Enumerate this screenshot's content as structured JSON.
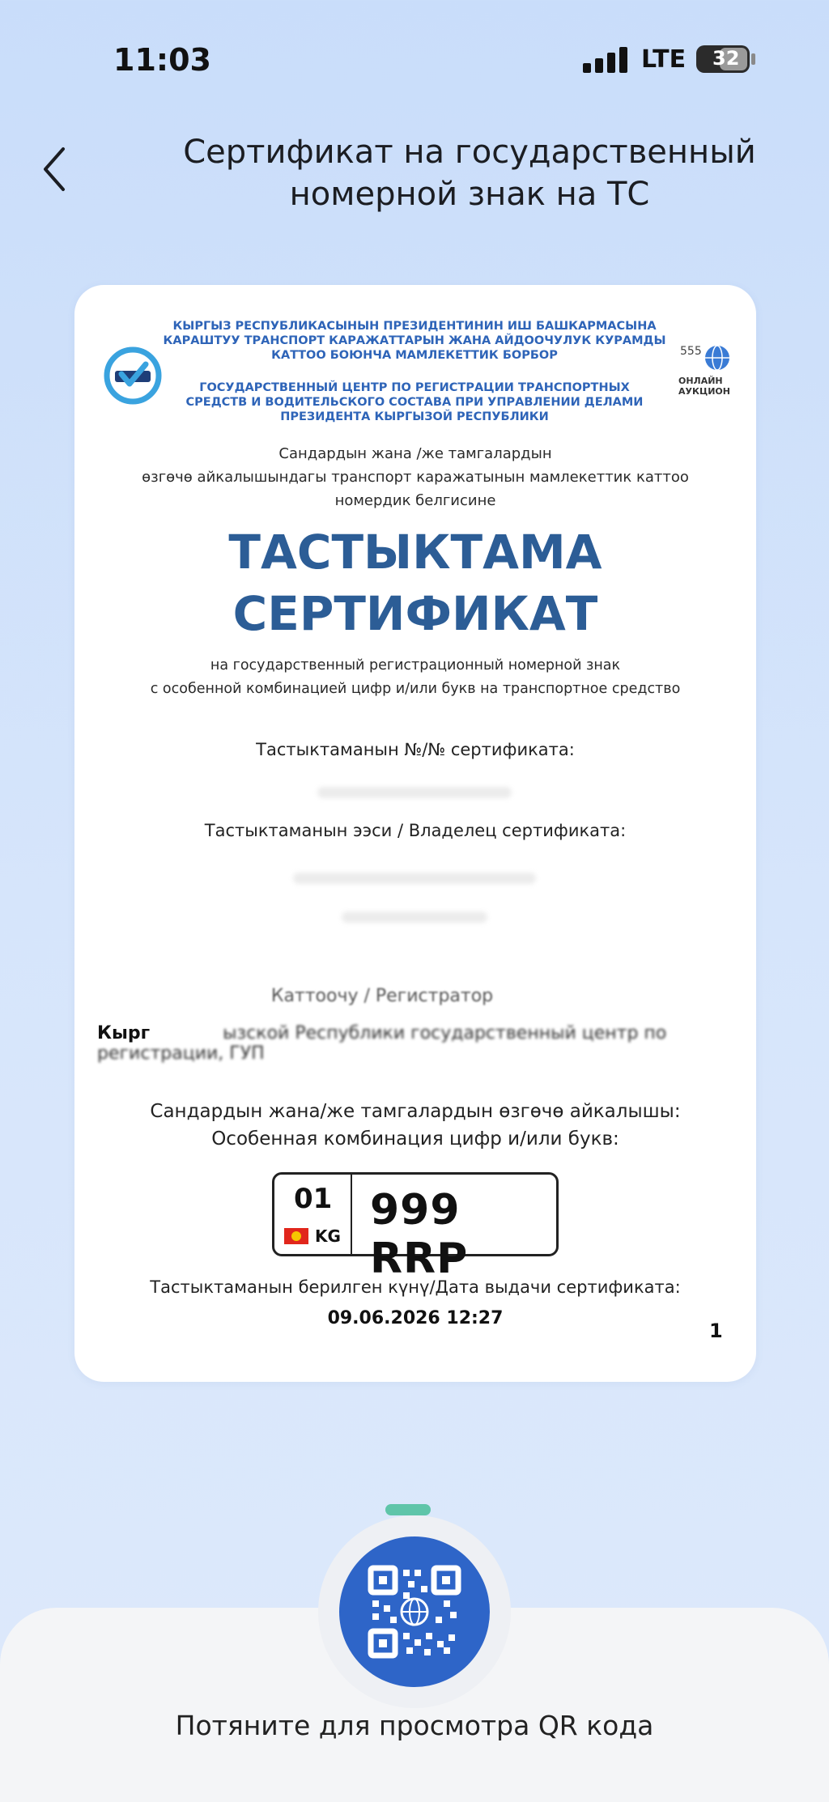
{
  "status_bar": {
    "time": "11:03",
    "network": "LTE",
    "battery": "32"
  },
  "header": {
    "title_line1": "Сертификат на государственный",
    "title_line2": "номерной знак на ТС",
    "back_icon": "chevron-left-icon"
  },
  "certificate": {
    "org_ky": [
      "КЫРГЫЗ РЕСПУБЛИКАСЫНЫН ПРЕЗИДЕНТИНИН ИШ БАШКАРМАСЫНА",
      "КАРАШТУУ ТРАНСПОРТ КАРАЖАТТАРЫН ЖАНА АЙДООЧУЛУК КУРАМДЫ",
      "КАТТОО БОЮНЧА МАМЛЕКЕТТИК БОРБОР"
    ],
    "org_ru": [
      "ГОСУДАРСТВЕННЫЙ ЦЕНТР ПО РЕГИСТРАЦИИ ТРАНСПОРТНЫХ",
      "СРЕДСТВ И ВОДИТЕЛЬСКОГО СОСТАВА ПРИ УПРАВЛЕНИИ ДЕЛАМИ",
      "ПРЕЗИДЕНТА КЫРГЫЗОЙ РЕСПУБЛИКИ"
    ],
    "right_logo_number": "555",
    "right_logo_label_1": "ОНЛАЙН",
    "right_logo_label_2": "АУКЦИОН",
    "subtitle_ky": [
      "Сандардын жана /же тамгалардын",
      "өзгөчө айкалышындагы транспорт каражатынын мамлекеттик каттоо",
      "номердик белгисине"
    ],
    "title_ky": "ТАСТЫКТАМА",
    "title_ru": "СЕРТИФИКАТ",
    "subtitle_ru": [
      "на государственный регистрационный номерной знак",
      "с особенной комбинацией цифр и/или букв на транспортное средство"
    ],
    "cert_number_label": "Тастыктаманын №/№ сертификата:",
    "cert_owner_label": "Тастыктаманын ээси / Владелец сертификата:",
    "registrar_label": "Каттоочу / Регистратор",
    "registrar_prefix": "Кырг",
    "registrar_text": "ызской Республики государственный центр по регистрации, ГУП",
    "combination_label_ky": "Сандардын жана/же тамгалардын өзгөчө айкалышы:",
    "combination_label_ru": "Особенная комбинация цифр и/или букв:",
    "issue_label": "Тастыктаманын берилген күнү/Дата выдачи сертификата:",
    "issue_date": "09.06.2026 12:27",
    "page_number": "1"
  },
  "plate": {
    "region": "01",
    "country": "KG",
    "number": "999 RRP",
    "flag_colors": {
      "field": "#e1261c",
      "sun": "#f6c500"
    }
  },
  "drawer": {
    "hint": "Потяните для просмотра QR кода",
    "qr_icon": "qr-code-icon"
  },
  "colors": {
    "accent_blue": "#2e65c8",
    "title_blue": "#2c5d96",
    "org_blue": "#2e64b8",
    "handle_green": "#5fc5a9"
  }
}
